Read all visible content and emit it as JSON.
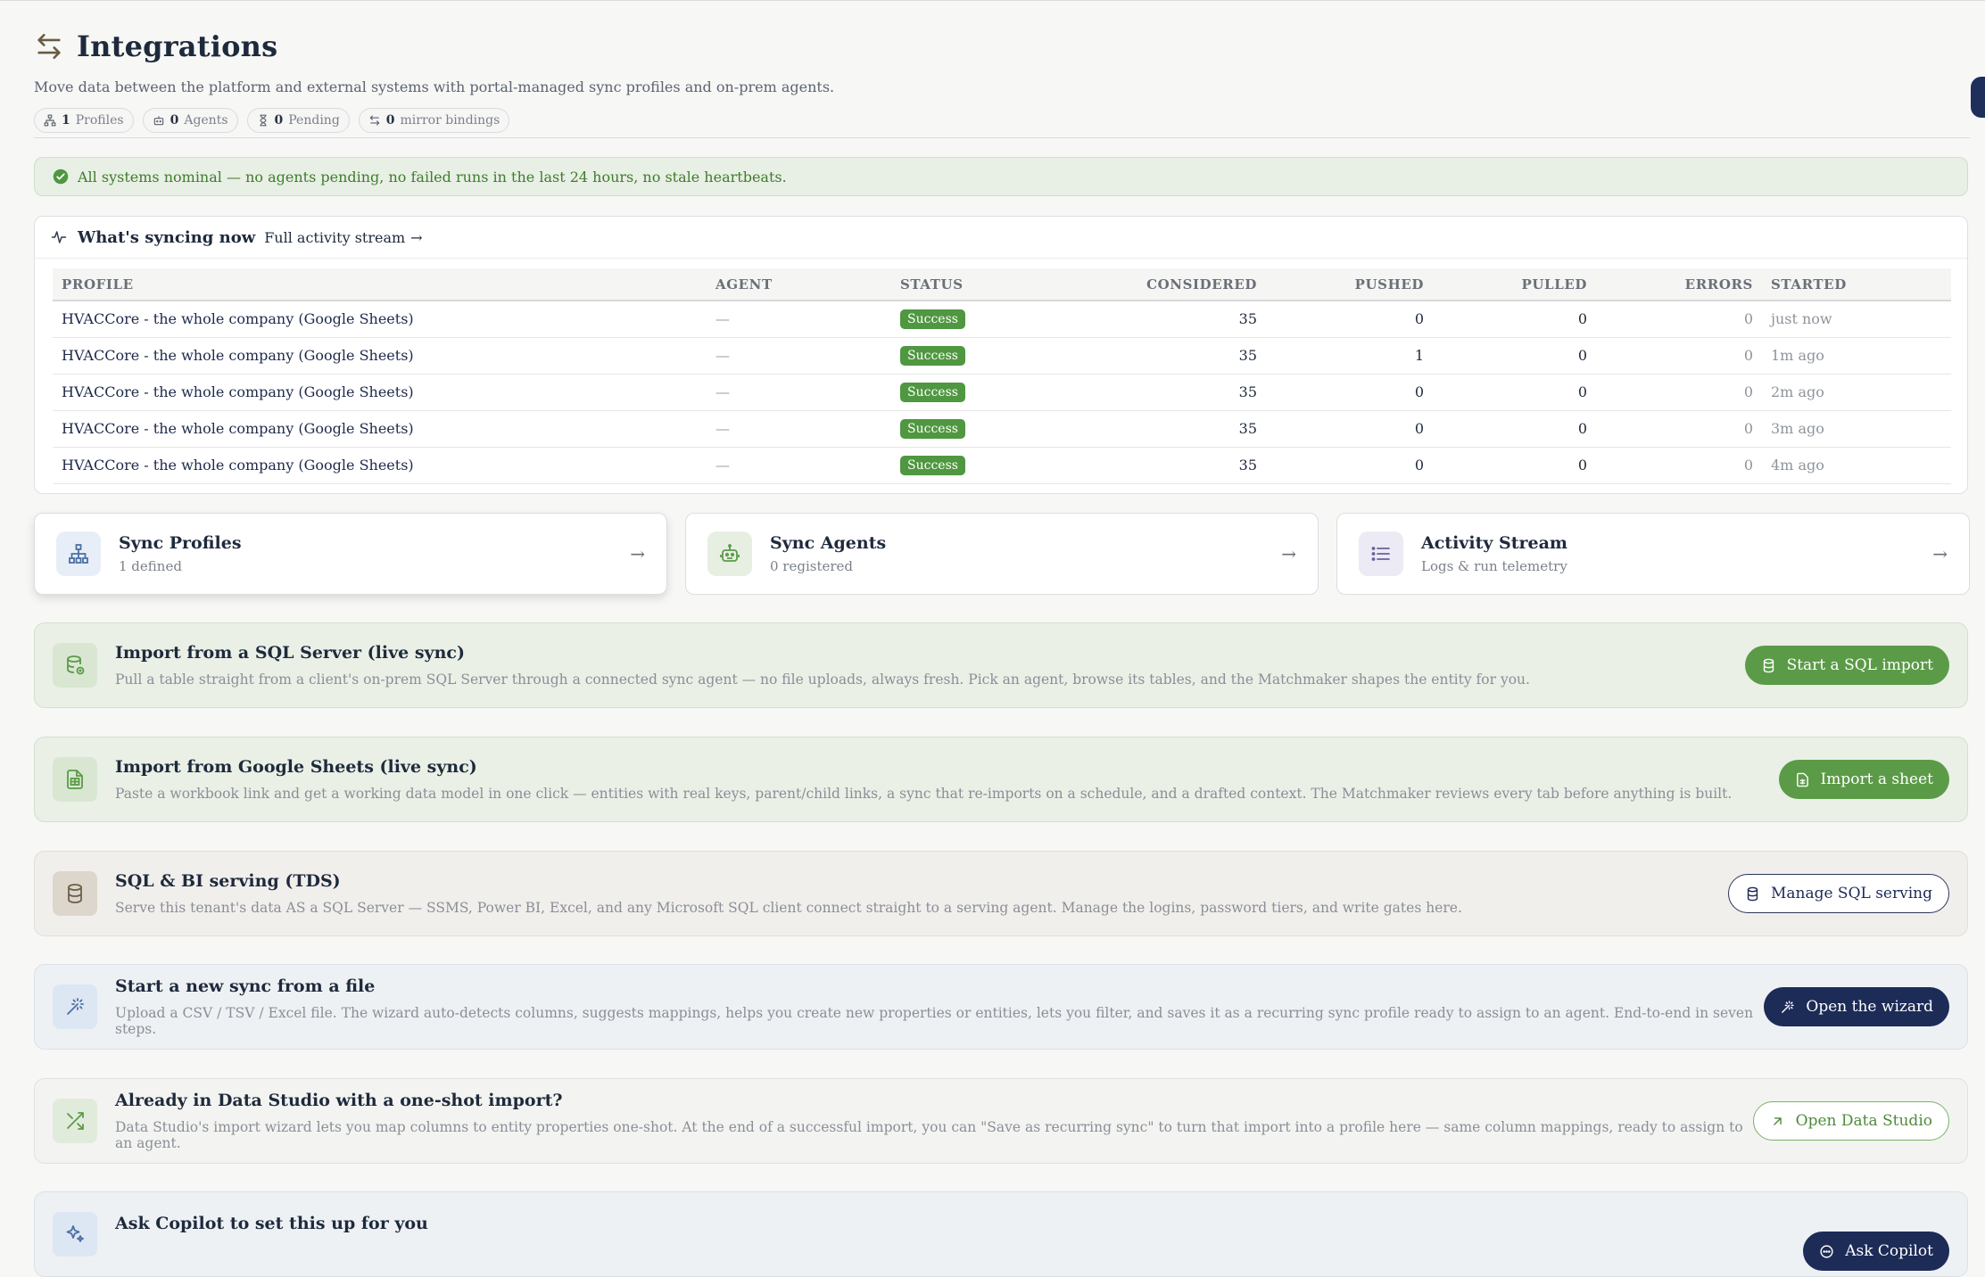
{
  "header": {
    "title": "Integrations",
    "subtitle": "Move data between the platform and external systems with portal-managed sync profiles and on-prem agents.",
    "chips": [
      {
        "count": "1",
        "label": "Profiles",
        "icon": "hierarchy-icon"
      },
      {
        "count": "0",
        "label": "Agents",
        "icon": "robot-icon"
      },
      {
        "count": "0",
        "label": "Pending",
        "icon": "hourglass-icon"
      },
      {
        "count": "0",
        "label": "mirror bindings",
        "icon": "swap-icon"
      }
    ]
  },
  "banner": {
    "text": "All systems nominal — no agents pending, no failed runs in the last 24 hours, no stale heartbeats.",
    "color": "#3e7d2e"
  },
  "activity": {
    "title": "What's syncing now",
    "link": "Full activity stream",
    "columns": [
      "PROFILE",
      "AGENT",
      "STATUS",
      "CONSIDERED",
      "PUSHED",
      "PULLED",
      "ERRORS",
      "STARTED"
    ],
    "rows": [
      {
        "profile": "HVACCore - the whole company (Google Sheets)",
        "agent": "—",
        "status": "Success",
        "considered": "35",
        "pushed": "0",
        "pulled": "0",
        "errors": "0",
        "started": "just now"
      },
      {
        "profile": "HVACCore - the whole company (Google Sheets)",
        "agent": "—",
        "status": "Success",
        "considered": "35",
        "pushed": "1",
        "pulled": "0",
        "errors": "0",
        "started": "1m ago"
      },
      {
        "profile": "HVACCore - the whole company (Google Sheets)",
        "agent": "—",
        "status": "Success",
        "considered": "35",
        "pushed": "0",
        "pulled": "0",
        "errors": "0",
        "started": "2m ago"
      },
      {
        "profile": "HVACCore - the whole company (Google Sheets)",
        "agent": "—",
        "status": "Success",
        "considered": "35",
        "pushed": "0",
        "pulled": "0",
        "errors": "0",
        "started": "3m ago"
      },
      {
        "profile": "HVACCore - the whole company (Google Sheets)",
        "agent": "—",
        "status": "Success",
        "considered": "35",
        "pushed": "0",
        "pulled": "0",
        "errors": "0",
        "started": "4m ago"
      }
    ]
  },
  "nav": [
    {
      "title": "Sync Profiles",
      "sub": "1 defined",
      "icon": "hierarchy-icon",
      "color": "#4a6fa5"
    },
    {
      "title": "Sync Agents",
      "sub": "0 registered",
      "icon": "robot-icon",
      "color": "#5b9b47"
    },
    {
      "title": "Activity Stream",
      "sub": "Logs & run telemetry",
      "icon": "list-icon",
      "color": "#6b5fa0"
    }
  ],
  "actions": [
    {
      "title": "Import from a SQL Server (live sync)",
      "desc": "Pull a table straight from a client's on-prem SQL Server through a connected sync agent — no file uploads, always fresh. Pick an agent, browse its tables, and the Matchmaker shapes the entity for you.",
      "button": "Start a SQL import"
    },
    {
      "title": "Import from Google Sheets (live sync)",
      "desc": "Paste a workbook link and get a working data model in one click — entities with real keys, parent/child links, a sync that re-imports on a schedule, and a drafted context. The Matchmaker reviews every tab before anything is built.",
      "button": "Import a sheet"
    },
    {
      "title": "SQL & BI serving (TDS)",
      "desc": "Serve this tenant's data AS a SQL Server — SSMS, Power BI, Excel, and any Microsoft SQL client connect straight to a serving agent. Manage the logins, password tiers, and write gates here.",
      "button": "Manage SQL serving"
    },
    {
      "title": "Start a new sync from a file",
      "desc": "Upload a CSV / TSV / Excel file. The wizard auto-detects columns, suggests mappings, helps you create new properties or entities, lets you filter, and saves it as a recurring sync profile ready to assign to an agent. End-to-end in seven steps.",
      "button": "Open the wizard"
    },
    {
      "title": "Already in Data Studio with a one-shot import?",
      "desc": "Data Studio's import wizard lets you map columns to entity properties one-shot. At the end of a successful import, you can \"Save as recurring sync\" to turn that import into a profile here — same column mappings, ready to assign to an agent.",
      "button": "Open Data Studio"
    },
    {
      "title": "Ask Copilot to set this up for you",
      "desc": "",
      "button": "Ask Copilot"
    }
  ]
}
